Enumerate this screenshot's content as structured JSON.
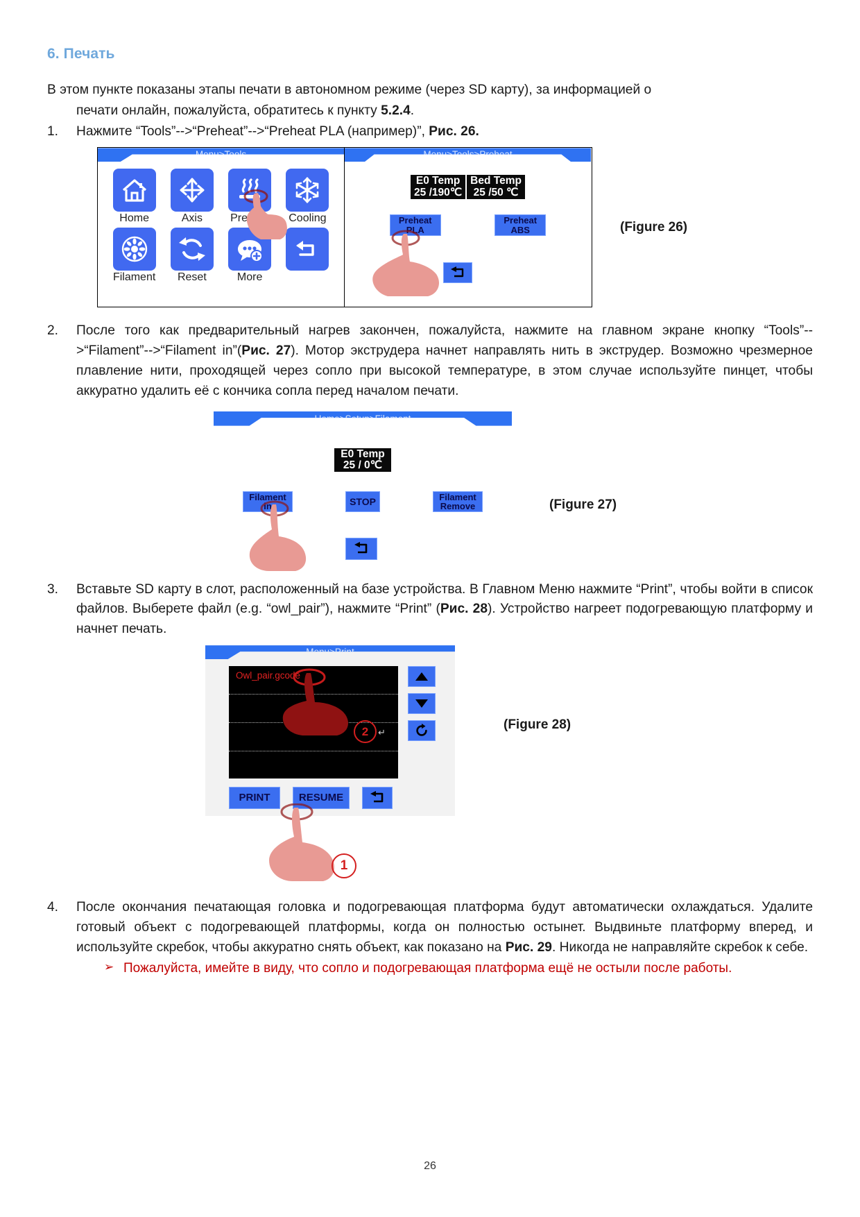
{
  "section": {
    "title": "6. Печать"
  },
  "intro": {
    "line1": "В этом пункте показаны этапы печати в автономном режиме (через SD карту), за информацией о",
    "line2_pre": "печати онлайн, пожалуйста, обратитесь к пункту ",
    "line2_bold": "5.2.4",
    "line2_post": "."
  },
  "steps": [
    {
      "num": "1.",
      "pre": "Нажмите “Tools”-->“Preheat”-->“Preheat PLA (например)”, ",
      "bold": "Рис. 26.",
      "post": ""
    },
    {
      "num": "2.",
      "pre": "После того как предварительный нагрев закончен, пожалуйста, нажмите на главном экране кнопку “Tools”-->“Filament”-->“Filament in”(",
      "bold": "Рис. 27",
      "post": "). Мотор экструдера начнет направлять нить в экструдер. Возможно чрезмерное плавление нити, проходящей через сопло при высокой температуре, в этом случае используйте пинцет, чтобы аккуратно удалить её с кончика сопла перед началом печати."
    },
    {
      "num": "3.",
      "pre": "Вставьте SD карту в слот, расположенный на базе устройства. В Главном Меню нажмите “Print”, чтобы войти в список файлов. Выберете файл (e.g. “owl_pair”), нажмите “Print” (",
      "bold": "Рис. 28",
      "post": "). Устройство нагреет подогревающую платформу и начнет печать."
    },
    {
      "num": "4.",
      "pre": "После окончания печатающая головка и подогревающая платформа будут автоматически охлаждаться. Удалите готовый объект с подогревающей платформы, когда он полностью остынет. Выдвиньте платформу вперед, и используйте скребок, чтобы аккуратно снять объект, как показано на ",
      "bold": "Рис. 29",
      "post": ". Никогда не направляйте скребок к себе."
    }
  ],
  "warning": {
    "bullet": "➢",
    "text": "Пожалуйста, имейте в виду, что сопло и подогревающая платформа ещё не остыли после работы."
  },
  "figure26": {
    "caption": "(Figure 26)",
    "left_panel": {
      "titlebar": "Menu>Tools",
      "tools": [
        {
          "label": "Home",
          "icon": "home-icon"
        },
        {
          "label": "Axis",
          "icon": "axis-arrows-icon"
        },
        {
          "label": "Preheat",
          "icon": "preheat-icon"
        },
        {
          "label": "Cooling",
          "icon": "snowflake-icon"
        },
        {
          "label": "Filament",
          "icon": "filament-spool-icon"
        },
        {
          "label": "Reset",
          "icon": "reset-circular-arrows-icon"
        },
        {
          "label": "More",
          "icon": "more-bubble-plus-icon"
        },
        {
          "label": "",
          "icon": "return-arrow-icon"
        }
      ]
    },
    "right_panel": {
      "titlebar": "Menu>Tools>Preheat",
      "temps": [
        {
          "head": "E0 Temp",
          "val": "25 /190℃"
        },
        {
          "head": "Bed Temp",
          "val": "25 /50 ℃"
        }
      ],
      "buttons": [
        {
          "line1": "Preheat",
          "line2": "PLA"
        },
        {
          "line1": "Preheat",
          "line2": "ABS"
        }
      ],
      "return_icon": "return-arrow-icon"
    }
  },
  "figure27": {
    "caption": "(Figure 27)",
    "titlebar": "Home>Setup>Filament",
    "temps": [
      {
        "head": "E0 Temp",
        "val": "25 /  0℃"
      }
    ],
    "buttons": [
      {
        "line1": "Filament",
        "line2": "in"
      },
      {
        "line1": "STOP",
        "line2": ""
      },
      {
        "line1": "Filament",
        "line2": "Remove"
      }
    ],
    "return_icon": "return-arrow-icon"
  },
  "figure28": {
    "caption": "(Figure 28)",
    "titlebar": "Menu>Print",
    "file_name": "Owl_pair.gcode",
    "side_buttons": [
      {
        "icon": "arrow-up-icon"
      },
      {
        "icon": "arrow-down-icon"
      },
      {
        "icon": "refresh-icon"
      },
      {
        "icon": "return-arrow-icon"
      }
    ],
    "buttons": [
      {
        "label": "PRINT"
      },
      {
        "label": "RESUME"
      }
    ],
    "markers": [
      {
        "label": "1"
      },
      {
        "label": "2"
      }
    ],
    "enter_symbol": "↵"
  },
  "footer": {
    "page_number": "26"
  },
  "colors": {
    "heading": "#6fa8dc",
    "lcd_blue": "#2f72f2",
    "button_blue": "#3b6ef0",
    "warning_red": "#c00000",
    "file_red": "#e12121",
    "hand_pink": "#e89a94",
    "hand_dark_red": "#8f1212"
  }
}
